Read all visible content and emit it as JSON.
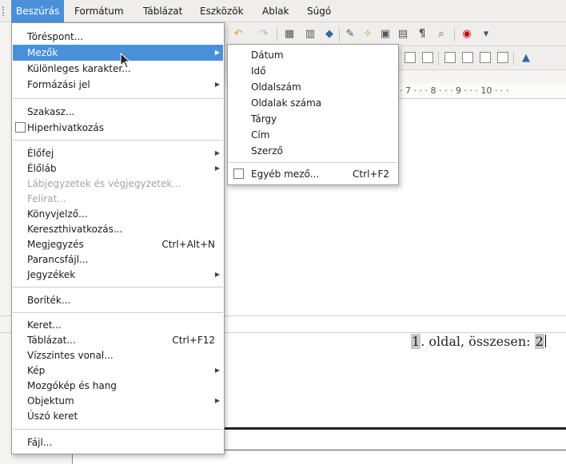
{
  "menubar": {
    "items": [
      "Beszúrás",
      "Formátum",
      "Táblázat",
      "Eszközök",
      "Ablak",
      "Súgó"
    ],
    "active": "Beszúrás"
  },
  "toolbar_icons": [
    "undo-icon",
    "redo-icon",
    "table-icon",
    "chart-icon",
    "navigator-icon",
    "gallery-icon",
    "data-sources-icon",
    "formatting-marks-icon",
    "zoom-icon",
    "help-icon"
  ],
  "ruler": {
    "text": "· 7 · · · 8 · · · 9 · · · 10 · · ·"
  },
  "insert_menu": {
    "items": [
      {
        "label": "Töréspont...",
        "accel": "",
        "submenu": false,
        "disabled": false
      },
      {
        "label": "Mezők",
        "accel": "",
        "submenu": true,
        "disabled": false,
        "highlighted": true
      },
      {
        "label": "Különleges karakter...",
        "accel": "",
        "submenu": false,
        "disabled": false
      },
      {
        "label": "Formázási jel",
        "accel": "",
        "submenu": true,
        "disabled": false
      },
      {
        "label": "Szakasz...",
        "accel": "",
        "submenu": false,
        "disabled": false
      },
      {
        "label": "Hiperhivatkozás",
        "accel": "",
        "submenu": false,
        "disabled": false,
        "checkbox": true
      },
      {
        "label": "Élőfej",
        "accel": "",
        "submenu": true,
        "disabled": false
      },
      {
        "label": "Élőláb",
        "accel": "",
        "submenu": true,
        "disabled": false
      },
      {
        "label": "Lábjegyzetek és végjegyzetek...",
        "accel": "",
        "submenu": false,
        "disabled": true
      },
      {
        "label": "Felirat...",
        "accel": "",
        "submenu": false,
        "disabled": true
      },
      {
        "label": "Könyvjelző...",
        "accel": "",
        "submenu": false,
        "disabled": false
      },
      {
        "label": "Kereszthivatkozás...",
        "accel": "",
        "submenu": false,
        "disabled": false
      },
      {
        "label": "Megjegyzés",
        "accel": "Ctrl+Alt+N",
        "submenu": false,
        "disabled": false
      },
      {
        "label": "Parancsfájl...",
        "accel": "",
        "submenu": false,
        "disabled": false
      },
      {
        "label": "Jegyzékek",
        "accel": "",
        "submenu": true,
        "disabled": false
      },
      {
        "label": "Boríték...",
        "accel": "",
        "submenu": false,
        "disabled": false
      },
      {
        "label": "Keret...",
        "accel": "",
        "submenu": false,
        "disabled": false
      },
      {
        "label": "Táblázat...",
        "accel": "Ctrl+F12",
        "submenu": false,
        "disabled": false
      },
      {
        "label": "Vízszintes vonal...",
        "accel": "",
        "submenu": false,
        "disabled": false
      },
      {
        "label": "Kép",
        "accel": "",
        "submenu": true,
        "disabled": false
      },
      {
        "label": "Mozgókép és hang",
        "accel": "",
        "submenu": false,
        "disabled": false
      },
      {
        "label": "Objektum",
        "accel": "",
        "submenu": true,
        "disabled": false
      },
      {
        "label": "Úszó keret",
        "accel": "",
        "submenu": false,
        "disabled": false
      },
      {
        "label": "Fájl...",
        "accel": "",
        "submenu": false,
        "disabled": false
      }
    ]
  },
  "fields_submenu": {
    "items": [
      {
        "label": "Dátum",
        "accel": ""
      },
      {
        "label": "Idő",
        "accel": ""
      },
      {
        "label": "Oldalszám",
        "accel": ""
      },
      {
        "label": "Oldalak száma",
        "accel": ""
      },
      {
        "label": "Tárgy",
        "accel": ""
      },
      {
        "label": "Cím",
        "accel": ""
      },
      {
        "label": "Szerző",
        "accel": ""
      },
      {
        "label": "Egyéb mező...",
        "accel": "Ctrl+F2",
        "checkbox": true
      }
    ]
  },
  "document": {
    "footer_page": "1",
    "footer_mid": ". oldal, összesen: ",
    "footer_total": "2"
  }
}
